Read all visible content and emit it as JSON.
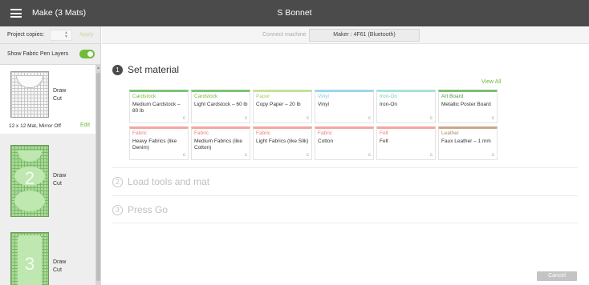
{
  "header": {
    "menu_icon": "hamburger-icon",
    "app_title": "Make (3 Mats)",
    "project_name": "S Bonnet"
  },
  "left_panel": {
    "project_copies_label": "Project copies:",
    "project_copies_value": "",
    "apply_label": "Apply",
    "fabric_pen_label": "Show Fabric Pen Layers",
    "fabric_pen_on": true,
    "mats": [
      {
        "number": "",
        "line1": "Draw",
        "line2": "Cut",
        "info": "12 x 12 Mat, Mirror Off",
        "edit": "Edit"
      },
      {
        "number": "2",
        "line1": "Draw",
        "line2": "Cut"
      },
      {
        "number": "3",
        "line1": "Draw",
        "line2": "Cut"
      }
    ]
  },
  "connect": {
    "label": "Connect machine",
    "machine": "Maker : 4F61 (Bluetooth)"
  },
  "steps": [
    {
      "number": "1",
      "title": "Set material"
    },
    {
      "number": "2",
      "title": "Load tools and mat"
    },
    {
      "number": "3",
      "title": "Press Go"
    }
  ],
  "materials": {
    "view_all": "View All",
    "tiles": [
      {
        "category": "Cardstock",
        "name": "Medium Cardstock – 80 lb",
        "color": "#7cc576",
        "catcolor": "#6dbd36"
      },
      {
        "category": "Cardstock",
        "name": "Light Cardstock – 60 lb",
        "color": "#7cc576",
        "catcolor": "#6dbd36"
      },
      {
        "category": "Paper",
        "name": "Copy Paper – 20 lb",
        "color": "#c4e29a",
        "catcolor": "#a6cf6f"
      },
      {
        "category": "Vinyl",
        "name": "Vinyl",
        "color": "#9bd8ec",
        "catcolor": "#7ec8e3"
      },
      {
        "category": "Iron-On",
        "name": "Iron-On",
        "color": "#a7e3d7",
        "catcolor": "#6fcfbd"
      },
      {
        "category": "Art Board",
        "name": "Metallic Poster Board",
        "color": "#7cbf72",
        "catcolor": "#4e9a45"
      },
      {
        "category": "Fabric",
        "name": "Heavy Fabrics (like Denim)",
        "color": "#f1a7a0",
        "catcolor": "#ef7e77"
      },
      {
        "category": "Fabric",
        "name": "Medium Fabrics (like Cotton)",
        "color": "#f1a7a0",
        "catcolor": "#ef7e77"
      },
      {
        "category": "Fabric",
        "name": "Light Fabrics (like Silk)",
        "color": "#f1a7a0",
        "catcolor": "#ef7e77"
      },
      {
        "category": "Fabric",
        "name": "Cotton",
        "color": "#f1a7a0",
        "catcolor": "#ef7e77"
      },
      {
        "category": "Felt",
        "name": "Felt",
        "color": "#f1a7a0",
        "catcolor": "#ef7e77"
      },
      {
        "category": "Leather",
        "name": "Faux Leather – 1 mm",
        "color": "#c9a98b",
        "catcolor": "#b08a6a"
      }
    ],
    "tile_icon": "c"
  },
  "footer": {
    "cancel_label": "Cancel"
  }
}
